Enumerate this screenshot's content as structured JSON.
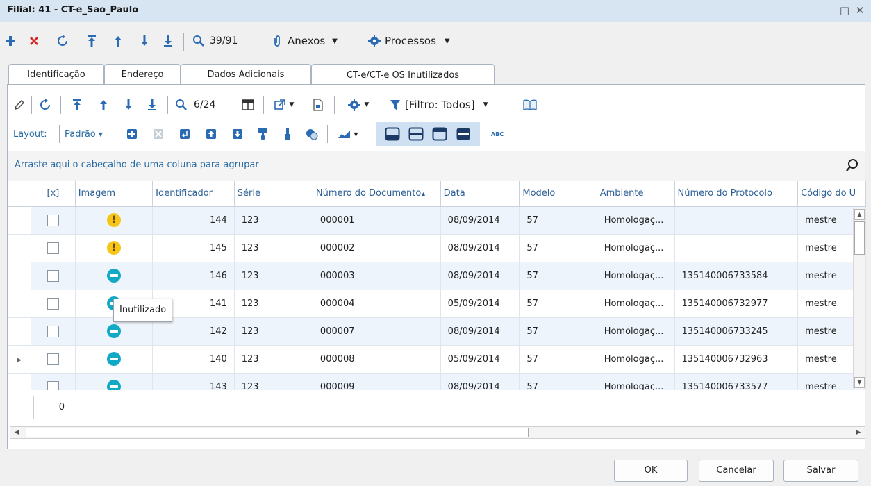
{
  "window": {
    "title": "Filial: 41 - CT-e_São_Paulo",
    "maximize_glyph": "□",
    "close_glyph": "✕"
  },
  "toolbar": {
    "record_counter": "39/91",
    "attachments_label": "Anexos",
    "processes_label": "Processos"
  },
  "tabs": [
    {
      "label": "Identificação",
      "active": false
    },
    {
      "label": "Endereço",
      "active": false
    },
    {
      "label": "Dados Adicionais",
      "active": false
    },
    {
      "label": "CT-e/CT-e OS Inutilizados",
      "active": true
    }
  ],
  "grid_toolbar": {
    "record_counter": "6/24",
    "filter_label": "[Filtro: Todos]",
    "layout_label": "Layout:",
    "layout_value": "Padrão",
    "abc_label": "ABC"
  },
  "group_banner": {
    "text": "Arraste aqui o cabeçalho de uma coluna para agrupar"
  },
  "columns": {
    "check": "[x]",
    "imagem": "Imagem",
    "identificador": "Identificador",
    "serie": "Série",
    "numero_documento": "Número do Documento",
    "data": "Data",
    "modelo": "Modelo",
    "ambiente": "Ambiente",
    "numero_protocolo": "Número do Protocolo",
    "codigo_usuario": "Código do U"
  },
  "rows": [
    {
      "icon": "warning",
      "identificador": "144",
      "serie": "123",
      "numero": "000001",
      "data": "08/09/2014",
      "modelo": "57",
      "ambiente": "Homologaç...",
      "protocolo": "",
      "usuario": "mestre",
      "current": false
    },
    {
      "icon": "warning",
      "identificador": "145",
      "serie": "123",
      "numero": "000002",
      "data": "08/09/2014",
      "modelo": "57",
      "ambiente": "Homologaç...",
      "protocolo": "",
      "usuario": "mestre",
      "current": false
    },
    {
      "icon": "blocked",
      "identificador": "146",
      "serie": "123",
      "numero": "000003",
      "data": "08/09/2014",
      "modelo": "57",
      "ambiente": "Homologaç...",
      "protocolo": "135140006733584",
      "usuario": "mestre",
      "current": false
    },
    {
      "icon": "blocked",
      "identificador": "141",
      "serie": "123",
      "numero": "000004",
      "data": "05/09/2014",
      "modelo": "57",
      "ambiente": "Homologaç...",
      "protocolo": "135140006732977",
      "usuario": "mestre",
      "current": false
    },
    {
      "icon": "blocked",
      "identificador": "142",
      "serie": "123",
      "numero": "000007",
      "data": "08/09/2014",
      "modelo": "57",
      "ambiente": "Homologaç...",
      "protocolo": "135140006733245",
      "usuario": "mestre",
      "current": false
    },
    {
      "icon": "blocked",
      "identificador": "140",
      "serie": "123",
      "numero": "000008",
      "data": "05/09/2014",
      "modelo": "57",
      "ambiente": "Homologaç...",
      "protocolo": "135140006732963",
      "usuario": "mestre",
      "current": true
    },
    {
      "icon": "blocked",
      "identificador": "143",
      "serie": "123",
      "numero": "000009",
      "data": "08/09/2014",
      "modelo": "57",
      "ambiente": "Homologaç...",
      "protocolo": "135140006733577",
      "usuario": "mestre",
      "current": false
    }
  ],
  "tooltip": "Inutilizado",
  "footer": {
    "checked_count": "0"
  },
  "buttons": {
    "ok": "OK",
    "cancel": "Cancelar",
    "save": "Salvar"
  },
  "colors": {
    "accent": "#2a6bb4",
    "delete": "#d62828",
    "add": "#2a6bb4",
    "warning": "#f5c518",
    "blocked": "#12a9c6",
    "alt_row": "#eef4fb"
  }
}
